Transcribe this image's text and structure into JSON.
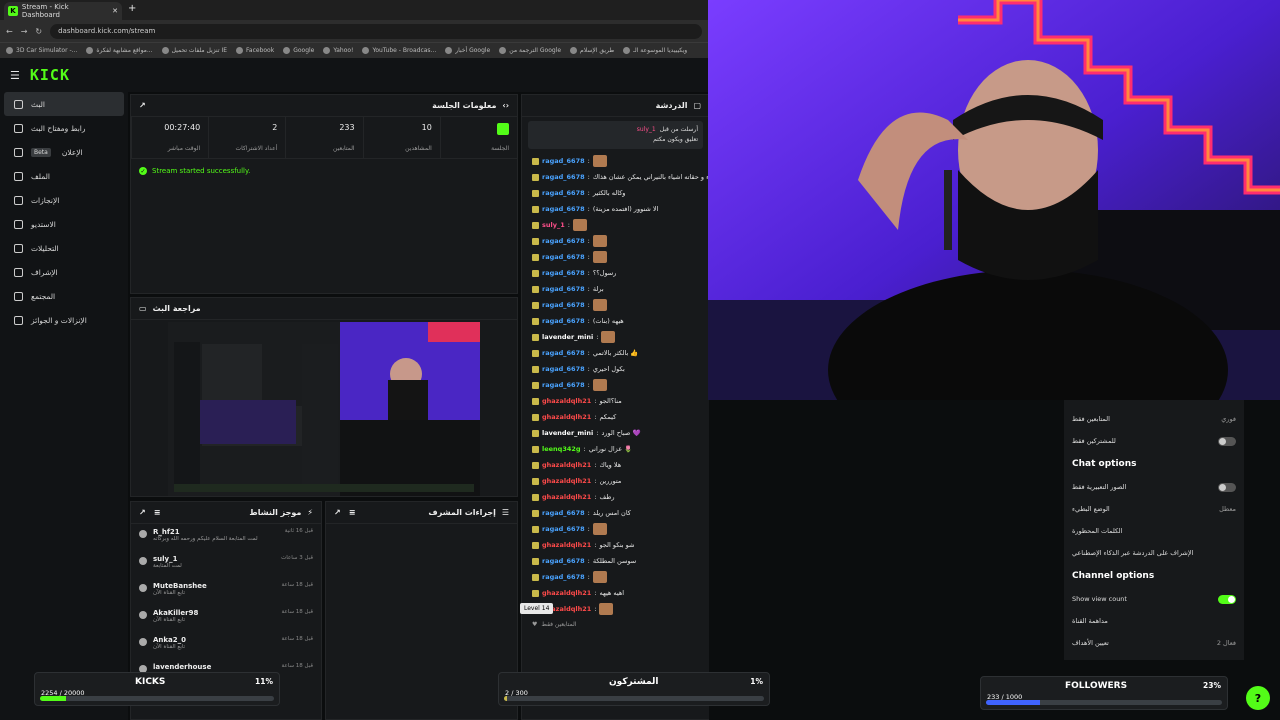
{
  "browser": {
    "tab_title": "Stream - Kick Dashboard",
    "url": "dashboard.kick.com/stream",
    "bookmarks": [
      "3D Car Simulator -...",
      "مواقع مشابهة لفكرة...",
      "تنزيل ملفات تحميل IE",
      "Facebook",
      "Google",
      "Yahoo!",
      "YouTube - Broadcas...",
      "أخبار Google",
      "الترجمة من Google",
      "طريق الإسلام",
      "ويكيبيديا الموسوعة الـ"
    ]
  },
  "app": {
    "logo": "KICK"
  },
  "sidebar": {
    "items": [
      {
        "label": "البث",
        "active": true
      },
      {
        "label": "رابط ومفتاح البث"
      },
      {
        "label": "الإعلان",
        "badge": "Beta"
      },
      {
        "label": "الملف"
      },
      {
        "label": "الإنجازات"
      },
      {
        "label": "الاستديو"
      },
      {
        "label": "التحليلات"
      },
      {
        "label": "الإشراف"
      },
      {
        "label": "المجتمع"
      },
      {
        "label": "الإنزالات و الجوائز"
      }
    ]
  },
  "session": {
    "title": "معلومات الجلسة",
    "stats": [
      {
        "value": "",
        "label": "الجلسة"
      },
      {
        "value": "10",
        "label": "المشاهدين"
      },
      {
        "value": "233",
        "label": "المتابعين"
      },
      {
        "value": "2",
        "label": "أعداد الاشتراكات"
      },
      {
        "value": "00:27:40",
        "label": "الوقت مباشر"
      }
    ],
    "success": "Stream started successfully."
  },
  "review": {
    "title": "مراجعة البث"
  },
  "feed": {
    "title": "موجز النشاط",
    "rows": [
      {
        "name": "R_hf21",
        "sub": "لمت المتابعة السلام عليكم ورحمه الله وبركاته",
        "time": "قبل 16 ثانية"
      },
      {
        "name": "suly_1",
        "sub": "لمت المتابعة",
        "time": "قبل 3 ساعات"
      },
      {
        "name": "MuteBanshee",
        "sub": "تابع القناة الآن",
        "time": "قبل 18 ساعة"
      },
      {
        "name": "AkaKiller98",
        "sub": "تابع القناة الآن",
        "time": "قبل 18 ساعة"
      },
      {
        "name": "Anka2_0",
        "sub": "تابع القناة الآن",
        "time": "قبل 18 ساعة"
      },
      {
        "name": "lavenderhouse",
        "sub": "",
        "time": "قبل 18 ساعة"
      }
    ]
  },
  "modlog": {
    "title": "إجراءات المشرف"
  },
  "chat": {
    "title": "الدردشة",
    "pinned_user": "suly_1",
    "pinned_text": "أرسلت من قبل",
    "pinned_body": "تعليق ويكون مكتم",
    "messages": [
      {
        "user": "ragad_6678",
        "text": "",
        "color": "#4aa3ff",
        "emote": true
      },
      {
        "user": "ragad_6678",
        "text": "بنات وأشياء و حقاته اشياء بالنيراني يمكن عشان هذاك",
        "color": "#4aa3ff"
      },
      {
        "user": "ragad_6678",
        "text": "وكاله بالكثير",
        "color": "#4aa3ff"
      },
      {
        "user": "ragad_6678",
        "text": "الا شنوور (افتمده مزينة)",
        "color": "#4aa3ff"
      },
      {
        "user": "suly_1",
        "text": "",
        "color": "#ff4f8b",
        "emote": true
      },
      {
        "user": "ragad_6678",
        "text": "",
        "color": "#4aa3ff",
        "emote": true
      },
      {
        "user": "ragad_6678",
        "text": "",
        "color": "#4aa3ff",
        "emote": true
      },
      {
        "user": "ragad_6678",
        "text": "رسول؟؟",
        "color": "#4aa3ff"
      },
      {
        "user": "ragad_6678",
        "text": "برلة",
        "color": "#4aa3ff"
      },
      {
        "user": "ragad_6678",
        "text": "",
        "color": "#4aa3ff",
        "emote": true
      },
      {
        "user": "ragad_6678",
        "text": "هيهه (بنات)",
        "color": "#4aa3ff"
      },
      {
        "user": "lavender_mini",
        "text": "",
        "color": "#ffffff",
        "emote": true
      },
      {
        "user": "ragad_6678",
        "text": "بالكثر بالاتمي 👍",
        "color": "#4aa3ff"
      },
      {
        "user": "ragad_6678",
        "text": "بكول احيري",
        "color": "#4aa3ff"
      },
      {
        "user": "ragad_6678",
        "text": "",
        "color": "#4aa3ff",
        "emote": true
      },
      {
        "user": "ghazaldqlh21",
        "text": "منا؟الجو",
        "color": "#ff4a4a"
      },
      {
        "user": "ghazaldqlh21",
        "text": "كيمكم",
        "color": "#ff4a4a"
      },
      {
        "user": "lavender_mini",
        "text": "صباح الورد 💜",
        "color": "#ffffff"
      },
      {
        "user": "leenq342g",
        "text": "عزال نوراني 🌷",
        "color": "#53fc18"
      },
      {
        "user": "ghazaldqlh21",
        "text": "هلا وياك",
        "color": "#ff4a4a"
      },
      {
        "user": "ghazaldqlh21",
        "text": "متوررين",
        "color": "#ff4a4a"
      },
      {
        "user": "ghazaldqlh21",
        "text": "رطف",
        "color": "#ff4a4a"
      },
      {
        "user": "ragad_6678",
        "text": "كان امس ريلد",
        "color": "#4aa3ff"
      },
      {
        "user": "ragad_6678",
        "text": "",
        "color": "#4aa3ff",
        "emote": true
      },
      {
        "user": "ghazaldqlh21",
        "text": "شو بنكو الجو",
        "color": "#ff4a4a"
      },
      {
        "user": "ragad_6678",
        "text": "سوسن المطلكة",
        "color": "#4aa3ff"
      },
      {
        "user": "ragad_6678",
        "text": "",
        "color": "#4aa3ff",
        "emote": true
      },
      {
        "user": "ghazaldqlh21",
        "text": "اهيه هيهه",
        "color": "#ff4a4a"
      },
      {
        "user": "ghazaldqlh21",
        "text": "",
        "color": "#ff4a4a",
        "emote": true
      }
    ],
    "tooltip": "Level 14",
    "footer": "المتابعين فقط"
  },
  "settings": {
    "rows_top": [
      {
        "label": "المتابعين فقط",
        "value": "فوري"
      },
      {
        "label": "للمشتركين فقط",
        "toggle": false
      }
    ],
    "chat_options_title": "Chat options",
    "chat_rows": [
      {
        "label": "الصور التعبيرية فقط",
        "toggle": false
      },
      {
        "label": "الوضع البطيء",
        "value": "معطل"
      },
      {
        "label": "الكلمات المحظورة",
        "value": ""
      },
      {
        "label": "الإشراف على الدردشة عبر الذكاء الإصطناعي",
        "value": ""
      }
    ],
    "channel_options_title": "Channel options",
    "channel_rows": [
      {
        "label": "Show view count",
        "toggle": true
      },
      {
        "label": "مداهمة القناة",
        "value": ""
      },
      {
        "label": "تعيين الأهداف",
        "value": "فعال 2"
      }
    ]
  },
  "goals": {
    "kicks": {
      "title": "KICKS",
      "count": "2254 / 20000",
      "percent": "11%",
      "fill": 0.11,
      "color": "#53fc18"
    },
    "subs": {
      "title": "المشتركون",
      "count": "2 / 300",
      "percent": "1%",
      "fill": 0.01,
      "color": "#c9b94a"
    },
    "followers": {
      "title": "FOLLOWERS",
      "count": "233 / 1000",
      "percent": "23%",
      "fill": 0.23,
      "color": "#3f63ff"
    }
  }
}
